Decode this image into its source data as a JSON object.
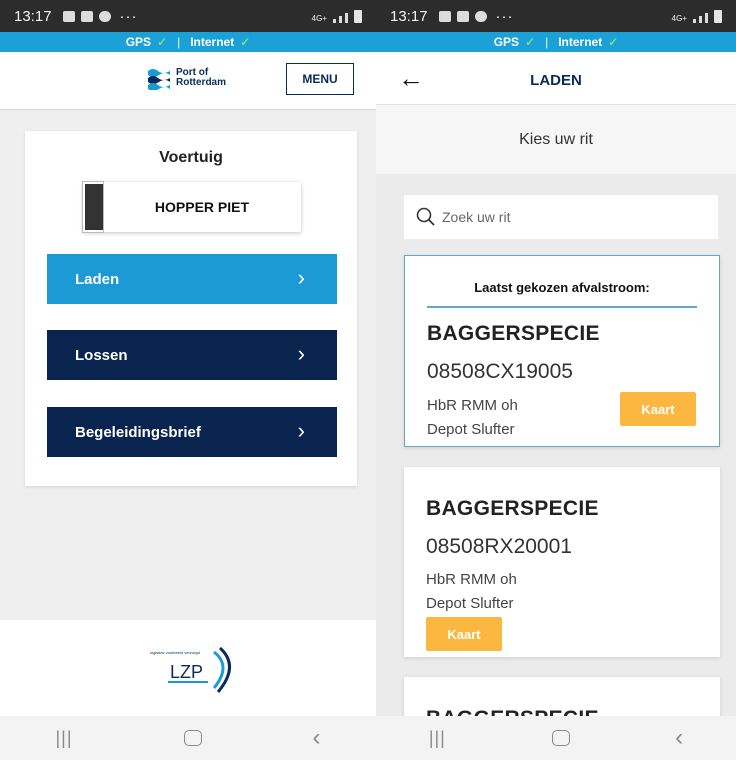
{
  "status": {
    "time": "13:17",
    "overflow": "···",
    "network": "4G+"
  },
  "connection": {
    "gps_label": "GPS",
    "internet_label": "Internet",
    "separator": "|",
    "check_color": "#7de07d"
  },
  "left": {
    "logo_text_line1": "Port of",
    "logo_text_line2": "Rotterdam",
    "menu_label": "MENU",
    "card_title": "Voertuig",
    "vehicle_name": "HOPPER PIET",
    "buttons": [
      {
        "label": "Laden",
        "color": "#1b9ad6"
      },
      {
        "label": "Lossen",
        "color": "#0a2450"
      },
      {
        "label": "Begeleidingsbrief",
        "color": "#0a2450"
      }
    ],
    "footer_logo_small": "logistiek voorbeeld verzorgd",
    "footer_logo_text": "LZP"
  },
  "right": {
    "title": "LADEN",
    "subtitle": "Kies uw rit",
    "search_placeholder": "Zoek uw rit",
    "last_chosen_label": "Laatst gekozen afvalstroom:",
    "trips": [
      {
        "type": "BAGGERSPECIE",
        "code": "08508CX19005",
        "line1": "HbR RMM oh",
        "line2": "Depot Slufter",
        "button": "Kaart"
      },
      {
        "type": "BAGGERSPECIE",
        "code": "08508RX20001",
        "line1": "HbR RMM oh",
        "line2": "Depot Slufter",
        "button": "Kaart"
      },
      {
        "type": "BAGGERSPECIE"
      }
    ]
  },
  "navbar": {
    "recent": "|||",
    "back": "‹"
  },
  "colors": {
    "accent_blue": "#1b9ad6",
    "navy": "#0a2450",
    "kaart_orange": "#fbb740",
    "gps_bar": "#1ba0d8"
  }
}
